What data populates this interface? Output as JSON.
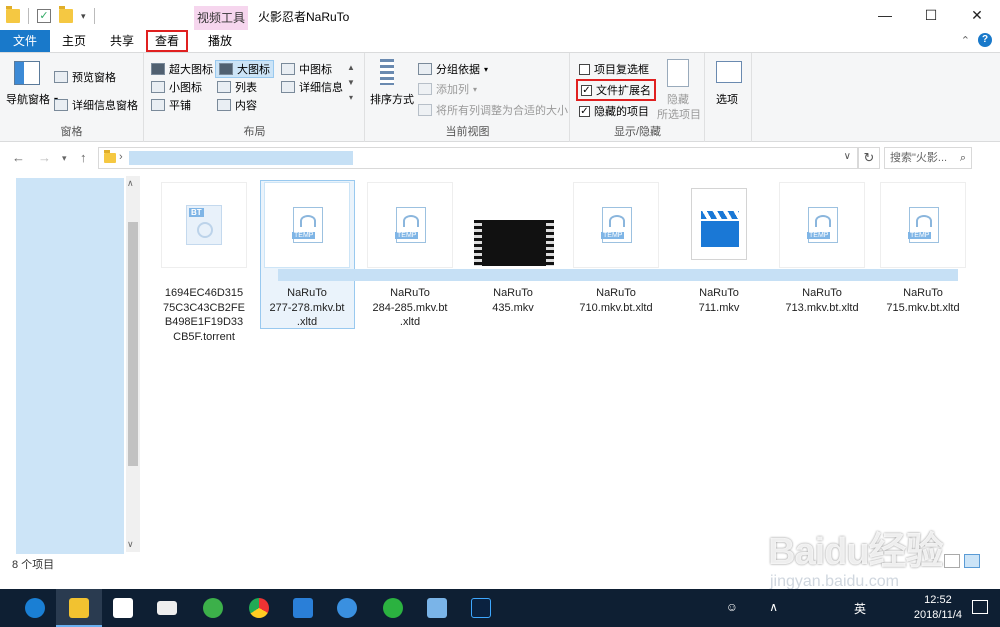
{
  "window": {
    "context_tab": "视频工具",
    "title": "火影忍者NaRuTo",
    "controls": {
      "minimize": "—",
      "maximize": "☐",
      "close": "✕"
    }
  },
  "tabs": {
    "file": "文件",
    "home": "主页",
    "share": "共享",
    "view": "查看",
    "play": "播放",
    "help": "?"
  },
  "ribbon": {
    "panes": {
      "nav_pane": "导航窗格",
      "preview_pane": "预览窗格",
      "details_pane": "详细信息窗格",
      "label": "窗格"
    },
    "layout": {
      "extra_large": "超大图标",
      "large": "大图标",
      "medium": "中图标",
      "small": "小图标",
      "list": "列表",
      "details": "详细信息",
      "tiles": "平铺",
      "content": "内容",
      "label": "布局"
    },
    "current_view": {
      "sort_by": "排序方式",
      "group_by": "分组依据",
      "add_columns": "添加列",
      "size_all": "将所有列调整为合适的大小",
      "label": "当前视图"
    },
    "show_hide": {
      "item_checkboxes": "项目复选框",
      "item_checkboxes_checked": false,
      "file_extensions": "文件扩展名",
      "file_extensions_checked": true,
      "hidden_items": "隐藏的项目",
      "hidden_items_checked": true,
      "hide_selected_1": "隐藏",
      "hide_selected_2": "所选项目",
      "label": "显示/隐藏"
    },
    "options": "选项"
  },
  "address": {
    "search_placeholder": "搜索\"火影..."
  },
  "files": [
    {
      "name": "1694EC46D31575C3C43CB2FEB498E1F19D33CB5F.torrent",
      "icon": "torrent-icon",
      "lines": [
        "1694EC46D315",
        "75C3C43CB2FE",
        "B498E1F19D33",
        "CB5F.torrent"
      ]
    },
    {
      "name": "NaRuTo 277-278.mkv.bt.xltd",
      "icon": "temp-file-icon",
      "lines": [
        "NaRuTo",
        "277-278.mkv.bt",
        ".xltd"
      ]
    },
    {
      "name": "NaRuTo 284-285.mkv.bt.xltd",
      "icon": "temp-file-icon",
      "lines": [
        "NaRuTo",
        "284-285.mkv.bt",
        ".xltd"
      ]
    },
    {
      "name": "NaRuTo 435.mkv",
      "icon": "video-thumbnail",
      "lines": [
        "NaRuTo",
        "435.mkv"
      ]
    },
    {
      "name": "NaRuTo 710.mkv.bt.xltd",
      "icon": "temp-file-icon",
      "lines": [
        "NaRuTo",
        "710.mkv.bt.xltd"
      ]
    },
    {
      "name": "NaRuTo 711.mkv",
      "icon": "clapperboard-icon",
      "lines": [
        "NaRuTo",
        "711.mkv"
      ]
    },
    {
      "name": "NaRuTo 713.mkv.bt.xltd",
      "icon": "temp-file-icon",
      "lines": [
        "NaRuTo",
        "713.mkv.bt.xltd"
      ]
    },
    {
      "name": "NaRuTo 715.mkv.bt.xltd",
      "icon": "temp-file-icon",
      "lines": [
        "NaRuTo",
        "715.mkv.bt.xltd"
      ]
    }
  ],
  "status": {
    "count": "8 个项目"
  },
  "taskbar": {
    "clock_time": "12:52",
    "clock_date": "2018/11/4",
    "ime": "英",
    "apps": [
      "edge-icon",
      "file-explorer-icon",
      "store-icon",
      "mail-icon",
      "sync-icon",
      "chrome-icon",
      "app-icon",
      "browser-icon",
      "wechat-icon",
      "notes-icon",
      "photoshop-icon"
    ]
  },
  "watermark": {
    "brand": "Baidu经验",
    "url": "jingyan.baidu.com"
  },
  "colors": {
    "accent": "#1979ca",
    "selection": "#cce4f7",
    "highlight_border": "#e02020",
    "context_tab": "#f6d6ee"
  }
}
